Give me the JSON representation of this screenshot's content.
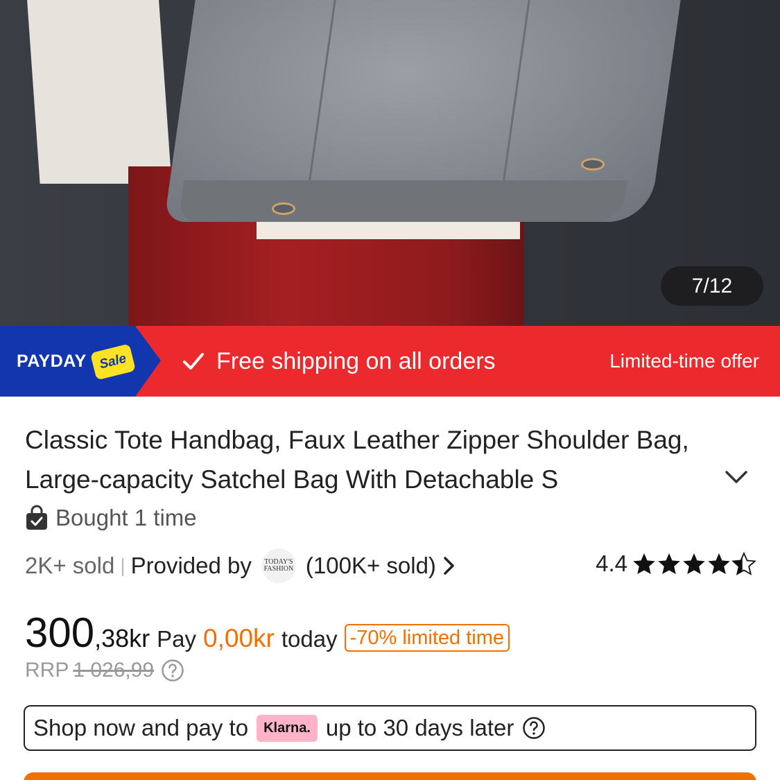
{
  "gallery": {
    "counter": "7/12"
  },
  "promo": {
    "payday_label": "PAYDAY",
    "sale_badge": "Sale",
    "shipping_text": "Free shipping on all orders",
    "offer_text": "Limited-time offer",
    "colors": {
      "banner": "#ec2a2e",
      "payday_bg": "#1136ae",
      "sale_badge": "#ffe224"
    }
  },
  "product": {
    "title": "Classic Tote Handbag, Faux Leather Zipper Shoulder Bag, Large-capacity Satchel Bag With Detachable S",
    "bought_text": "Bought 1 time",
    "sold_text": "2K+ sold",
    "provided_by_label": "Provided by",
    "store_logo_text": "TODAY'S FASHION",
    "store_sold_text": "(100K+ sold)",
    "rating": "4.4",
    "rating_value": 4.4,
    "rating_max": 5
  },
  "price": {
    "main": "300",
    "decimal": ",38kr",
    "pay_label": "Pay",
    "pay_amount": "0,00kr",
    "today_label": "today",
    "discount_badge": "-70% limited time",
    "rrp_label": "RRP",
    "rrp_value": "1 026,99",
    "accent_color": "#f07000"
  },
  "klarna": {
    "prefix": "Shop now and pay to",
    "logo": "Klarna.",
    "suffix": "up to 30 days later",
    "logo_color": "#ffb3c7"
  }
}
